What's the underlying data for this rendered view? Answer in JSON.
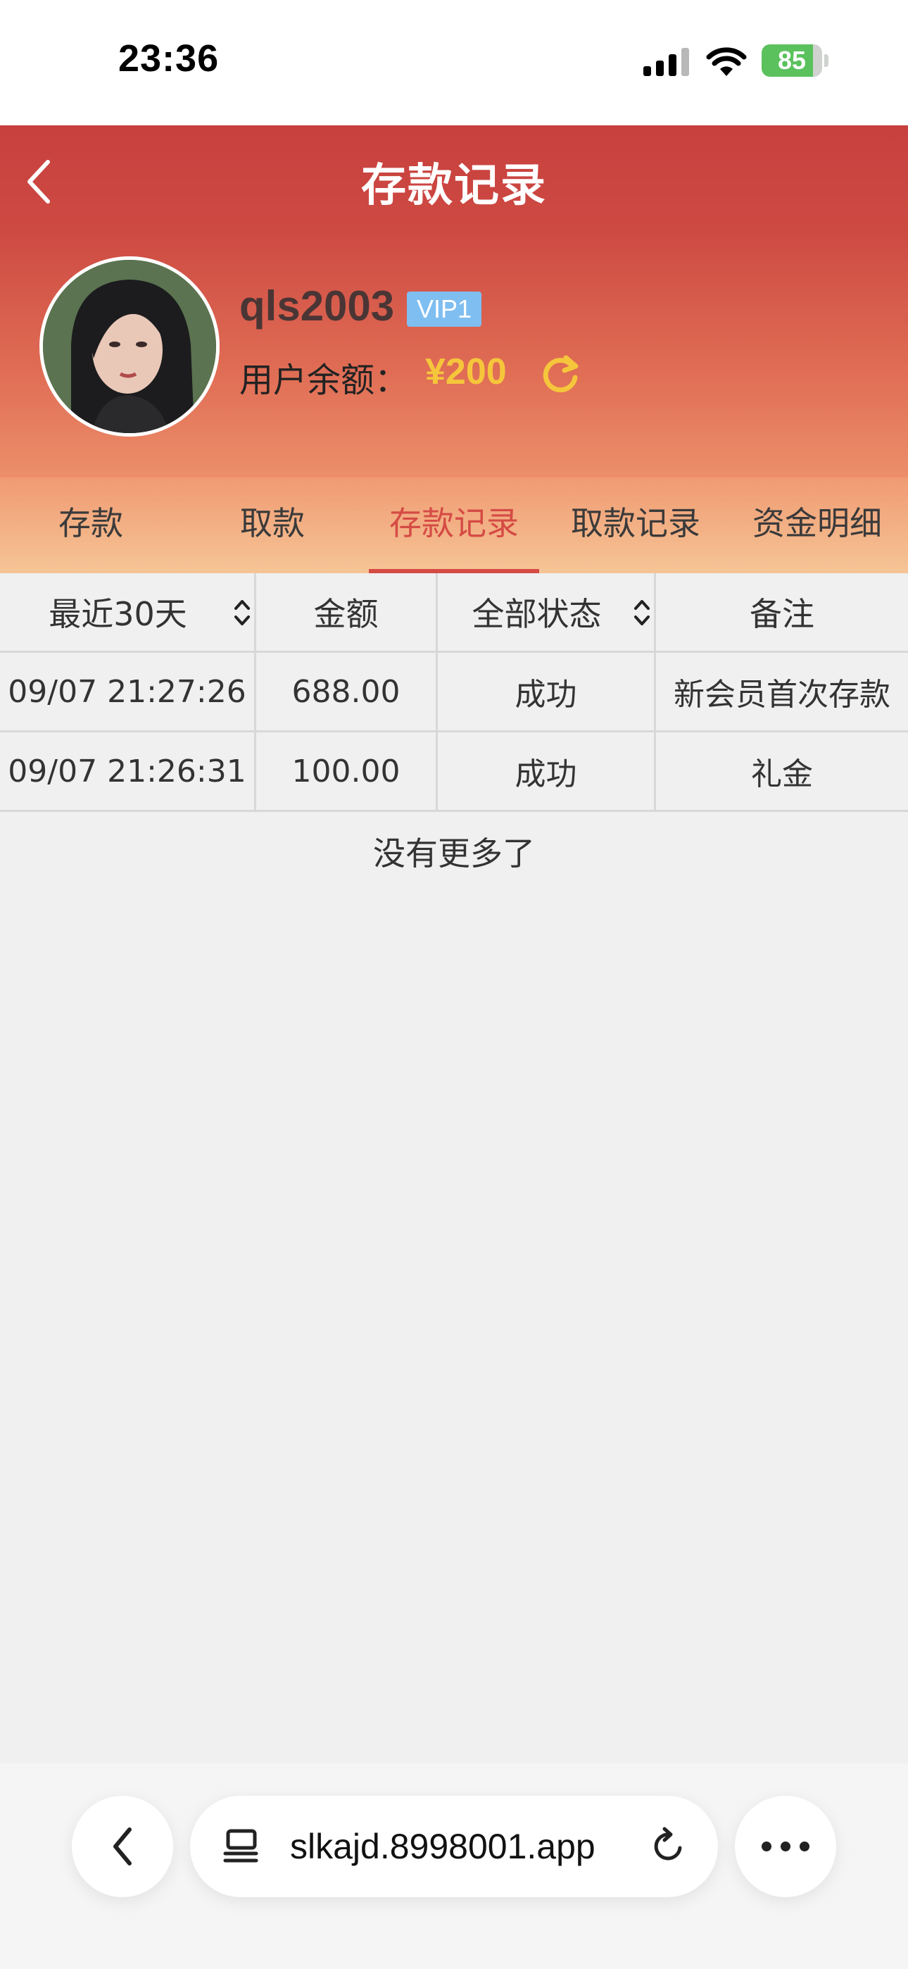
{
  "status_bar": {
    "time": "23:36",
    "battery": "85",
    "battery_level": 0.85,
    "icons": [
      "signal-icon",
      "wifi-icon",
      "battery-icon"
    ]
  },
  "header": {
    "title": "存款记录",
    "username": "qls2003",
    "vip": "VIP1",
    "balance_label": "用户余额：",
    "balance_value": "¥200"
  },
  "tabs": [
    {
      "label": "存款",
      "active": false
    },
    {
      "label": "取款",
      "active": false
    },
    {
      "label": "存款记录",
      "active": true
    },
    {
      "label": "取款记录",
      "active": false
    },
    {
      "label": "资金明细",
      "active": false
    }
  ],
  "table": {
    "filters": {
      "date_range": "最近30天",
      "amount": "金额",
      "status": "全部状态",
      "note": "备注"
    },
    "rows": [
      {
        "time": "09/07 21:27:26",
        "amount": "688.00",
        "status": "成功",
        "note": "新会员首次存款"
      },
      {
        "time": "09/07 21:26:31",
        "amount": "100.00",
        "status": "成功",
        "note": "礼金"
      }
    ],
    "end_text": "没有更多了"
  },
  "browser": {
    "url": "slkajd.8998001.app"
  },
  "colors": {
    "accent": "#d54b45",
    "balance": "#f5c63b",
    "vip": "#7fbef0",
    "header_top": "#c8403f",
    "header_bottom": "#ec8f6a"
  }
}
